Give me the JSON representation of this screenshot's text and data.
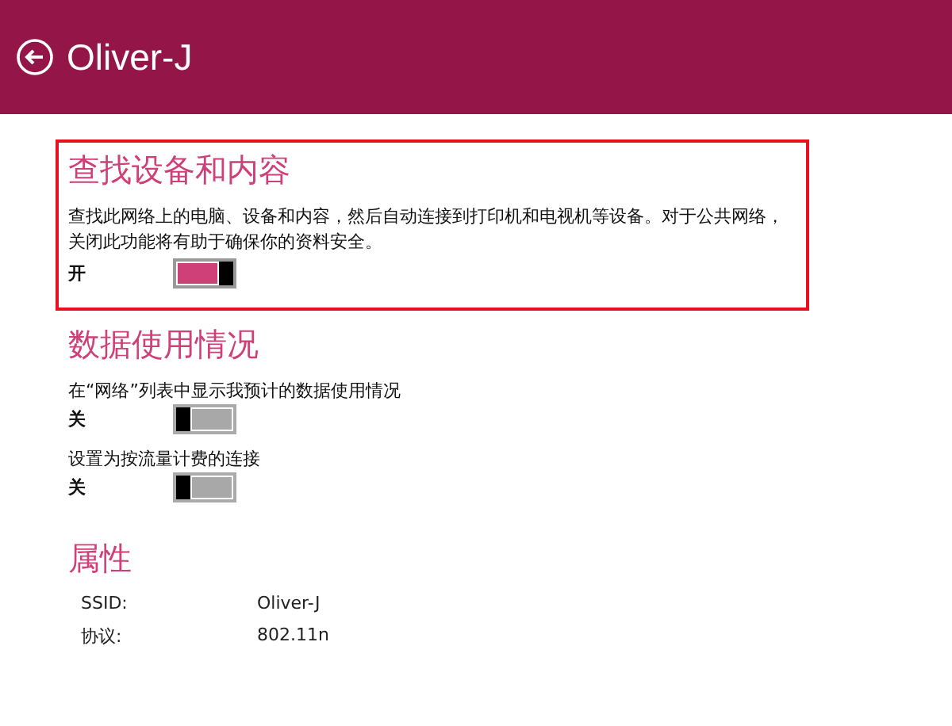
{
  "header": {
    "title": "Oliver-J"
  },
  "sections": [
    {
      "title": "查找设备和内容",
      "highlighted": true,
      "description": "查找此网络上的电脑、设备和内容，然后自动连接到打印机和电视机等设备。对于公共网络，关闭此功能将有助于确保你的资料安全。",
      "settings": [
        {
          "state_label": "开",
          "on": true
        }
      ]
    },
    {
      "title": "数据使用情况",
      "highlighted": false,
      "settings": [
        {
          "label": "在“网络”列表中显示我预计的数据使用情况",
          "state_label": "关",
          "on": false
        },
        {
          "label": "设置为按流量计费的连接",
          "state_label": "关",
          "on": false
        }
      ]
    }
  ],
  "properties": {
    "title": "属性",
    "rows": [
      {
        "name": "SSID:",
        "value": "Oliver-J"
      },
      {
        "name": "协议:",
        "value": "802.11n"
      }
    ]
  }
}
